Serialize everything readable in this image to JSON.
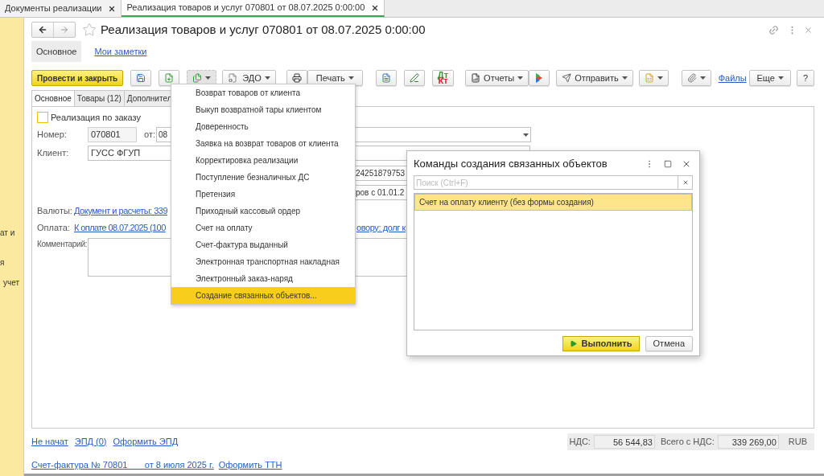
{
  "window_tabs": [
    {
      "label": "Документы реализации",
      "selected": false
    },
    {
      "label": "Реализация товаров и услуг 070801 от 08.07.2025 0:00:00",
      "selected": true
    }
  ],
  "sidebar_fragments": [
    "ат и",
    "я",
    "учет"
  ],
  "title": "Реализация товаров и услуг 070801 от 08.07.2025 0:00:00",
  "section_tabs": [
    {
      "label": "Основное",
      "selected": true
    },
    {
      "label": "Мои заметки",
      "selected": false
    }
  ],
  "toolbar": {
    "post_button": "Провести и закрыть",
    "edo_button": "ЭДО",
    "print_button": "Печать",
    "dtkt_icon": {
      "top": "Дт",
      "bottom": "Кт"
    },
    "reports_button": "Отчеты",
    "send_button": "Отправить",
    "files_link": "Файлы",
    "more_button": "Еще",
    "help_button": "?"
  },
  "form_tabs": [
    {
      "label": "Основное",
      "selected": true
    },
    {
      "label": "Товары (12)",
      "selected": false
    },
    {
      "label": "Дополнител",
      "selected": false
    }
  ],
  "form": {
    "order_checkbox": {
      "label": "Реализация по заказу",
      "checked": false
    },
    "number_label": "Номер:",
    "number_value": "070801",
    "date_label": "от:",
    "date_value": "08",
    "client_label": "Клиент:",
    "client_value": "ГУСС ФГУП",
    "contract_fragment": "24251879753",
    "period_fragment": "ров с 01.01.2",
    "currency_label": "Валюты:",
    "currency_link": "Документ и расчеты: 339",
    "payment_label": "Оплата:",
    "payment_link": "К оплате 08.07.2025 (100",
    "debt_link": "овору: долг к",
    "comment_label": "Комментарий:"
  },
  "create_menu": {
    "open": true,
    "items": [
      {
        "label": "Возврат товаров от клиента",
        "selected": false
      },
      {
        "label": "Выкуп возвратной тары клиентом",
        "selected": false
      },
      {
        "label": "Доверенность",
        "selected": false
      },
      {
        "label": "Заявка на возврат товаров от клиента",
        "selected": false
      },
      {
        "label": "Корректировка реализации",
        "selected": false
      },
      {
        "label": "Поступление безналичных ДС",
        "selected": false
      },
      {
        "label": "Претензия",
        "selected": false
      },
      {
        "label": "Приходный кассовый ордер",
        "selected": false
      },
      {
        "label": "Счет на оплату",
        "selected": false
      },
      {
        "label": "Счет-фактура выданный",
        "selected": false
      },
      {
        "label": "Электронная транспортная накладная",
        "selected": false
      },
      {
        "label": "Электронный заказ-наряд",
        "selected": false
      },
      {
        "label": "Создание связанных объектов...",
        "selected": true
      }
    ]
  },
  "dialog": {
    "title": "Команды создания связанных объектов",
    "search": {
      "placeholder": "Поиск (Ctrl+F)"
    },
    "rows": [
      {
        "label": "Счет на оплату клиенту (без формы создания)",
        "selected": true
      }
    ],
    "buttons": [
      {
        "label": "Выполнить",
        "kind": "primary"
      },
      {
        "label": "Отмена",
        "kind": "secondary"
      }
    ]
  },
  "footer": {
    "links": [
      "Не начат",
      "ЭПД (0)",
      "Оформить ЭПД"
    ],
    "vat_label": "НДС:",
    "vat_value": "56 544,83",
    "total_label": "Всего с НДС:",
    "total_value": "339 269,00",
    "currency": "RUB",
    "invoice_link": "Счет-фактура № 70801       от 8 июля 2025 г.",
    "ttn_link": "Оформить ТТН"
  }
}
